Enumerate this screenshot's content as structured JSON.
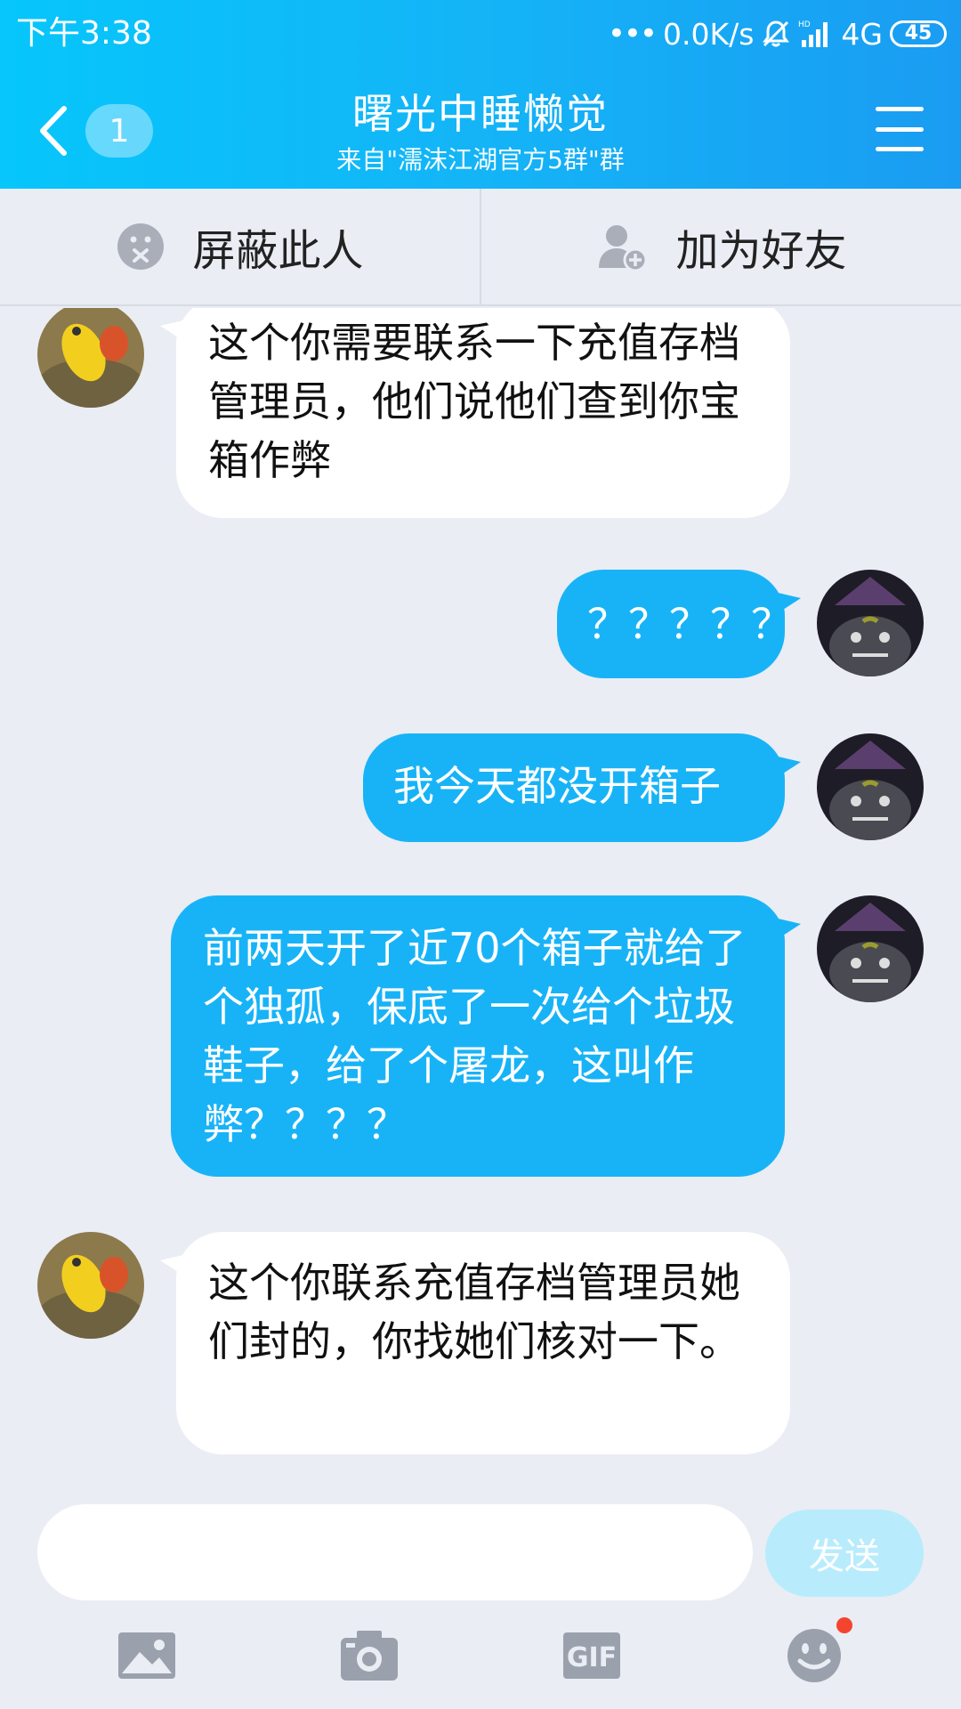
{
  "status_bar": {
    "time": "下午3:38",
    "network_speed": "0.0K/s",
    "network_type": "4G",
    "battery": "45"
  },
  "header": {
    "back_badge": "1",
    "title": "曙光中睡懒觉",
    "subtitle": "来自\"濡沫江湖官方5群\"群"
  },
  "actions": {
    "block": "屏蔽此人",
    "add_friend": "加为好友"
  },
  "messages": [
    {
      "side": "left",
      "text": "这个你需要联系一下充值存档管理员，他们说他们查到你宝箱作弊"
    },
    {
      "side": "right",
      "text": "？？？？？"
    },
    {
      "side": "right",
      "text": "我今天都没开箱子"
    },
    {
      "side": "right",
      "text": "前两天开了近70个箱子就给了个独孤，保底了一次给个垃圾鞋子，给了个屠龙，这叫作弊？？？？"
    },
    {
      "side": "left",
      "text": "这个你联系充值存档管理员她们封的，你找她们核对一下。"
    }
  ],
  "input": {
    "placeholder": "",
    "send_label": "发送"
  },
  "toolbar": {
    "gif_label": "GIF"
  },
  "colors": {
    "header_start": "#06c6fb",
    "header_end": "#1a9cf2",
    "bubble_self": "#18b3f7",
    "bubble_other": "#ffffff",
    "send_button": "#b8ecfc",
    "background": "#eaedf4"
  }
}
